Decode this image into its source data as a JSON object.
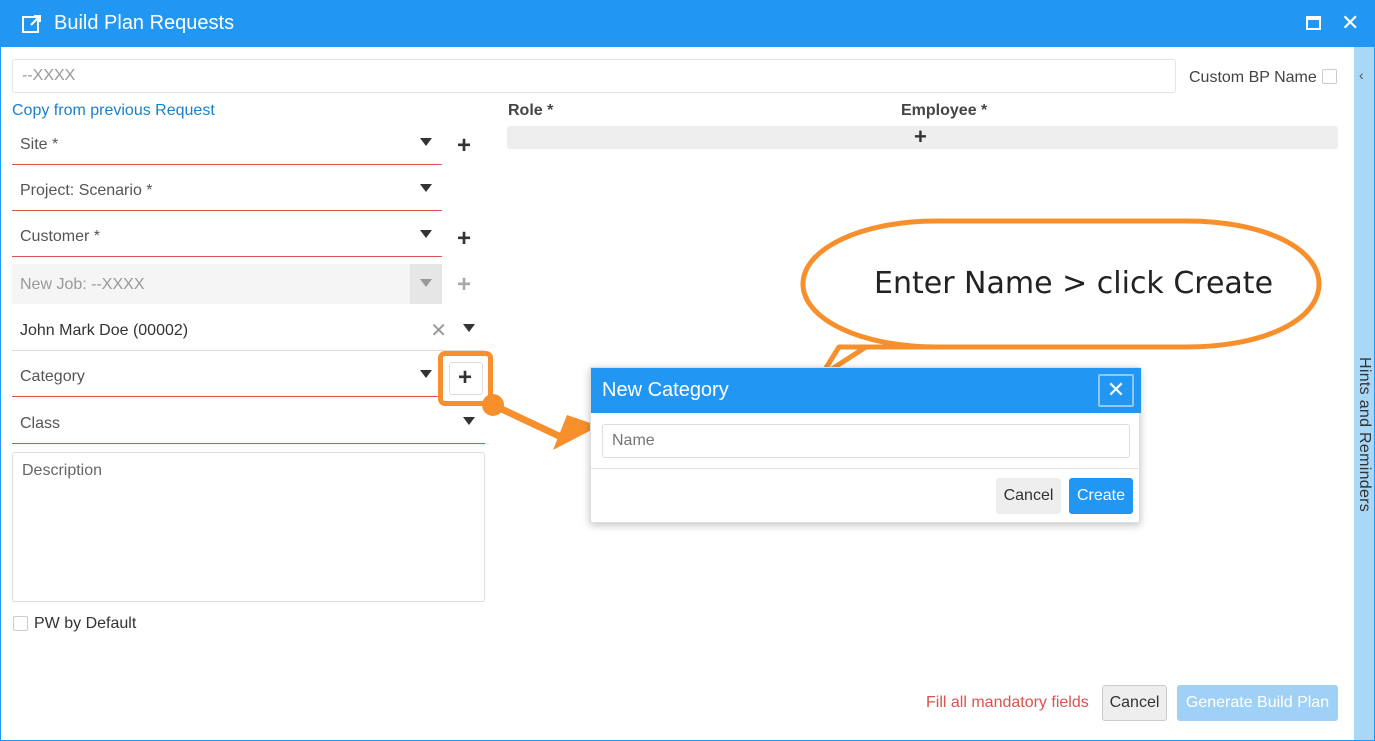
{
  "window": {
    "title": "Build Plan Requests",
    "icons": {
      "title": "external-link-icon",
      "maximize": "maximize-icon",
      "close": "close-icon"
    },
    "close_glyph": "✕"
  },
  "side_panel": {
    "label": "Hints and Reminders",
    "chevron": "‹"
  },
  "header": {
    "bp_name_value": "--XXXX",
    "custom_bp_label": "Custom BP Name"
  },
  "form": {
    "copy_link": "Copy from previous Request",
    "site": "Site *",
    "project": "Project: Scenario *",
    "customer": "Customer *",
    "new_job": "New Job: --XXXX",
    "employee_value": "John Mark Doe (00002)",
    "category": "Category",
    "class": "Class",
    "description_placeholder": "Description",
    "pw_default": "PW by Default",
    "plus": "+",
    "clear": "✕"
  },
  "table": {
    "role_header": "Role *",
    "employee_header": "Employee *"
  },
  "footer": {
    "mandatory_msg": "Fill all mandatory fields",
    "cancel": "Cancel",
    "generate": "Generate Build Plan"
  },
  "dialog": {
    "title": "New Category",
    "close_glyph": "✕",
    "name_placeholder": "Name",
    "cancel": "Cancel",
    "create": "Create"
  },
  "annotation": {
    "callout": "Enter Name  > click Create",
    "accent_color": "#f7902c"
  },
  "colors": {
    "primary": "#2196f3",
    "error": "#d9534f",
    "link": "#1b80c9"
  }
}
